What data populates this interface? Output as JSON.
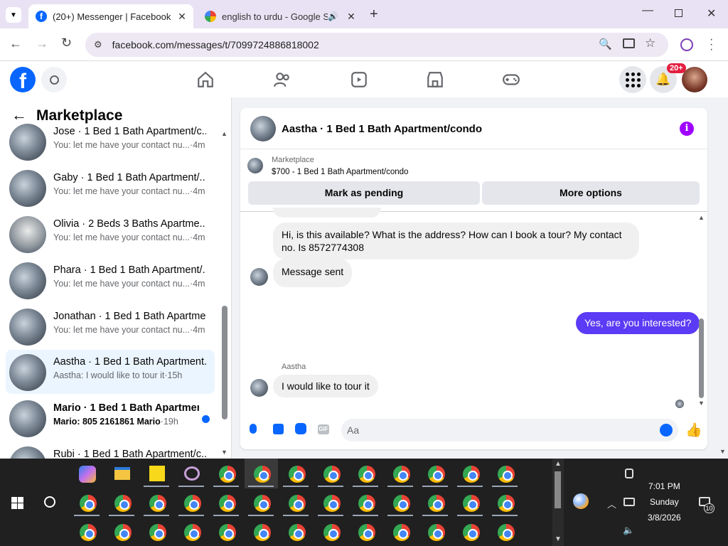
{
  "browser": {
    "tabs": [
      {
        "title": "(20+) Messenger | Facebook",
        "active": true
      },
      {
        "title": "english to urdu - Google Se",
        "active": false
      }
    ],
    "url": "facebook.com/messages/t/7099724886818002"
  },
  "fb": {
    "notification_badge": "20+",
    "brand_color": "#0866ff"
  },
  "sidebar": {
    "title": "Marketplace",
    "conversations": [
      {
        "name": "Jose · 1 Bed 1 Bath Apartment/c...",
        "snippet": "You: let me have your contact nu...",
        "time": "·4m"
      },
      {
        "name": "Gaby · 1 Bed 1 Bath Apartment/...",
        "snippet": "You: let me have your contact nu...",
        "time": "·4m"
      },
      {
        "name": "Olivia · 2 Beds 3 Baths Apartme...",
        "snippet": "You: let me have your contact nu...",
        "time": "·4m"
      },
      {
        "name": "Phara · 1 Bed 1 Bath Apartment/...",
        "snippet": "You: let me have your contact nu...",
        "time": "·4m"
      },
      {
        "name": "Jonathan · 1 Bed 1 Bath Apartme...",
        "snippet": "You: let me have your contact nu...",
        "time": "·4m"
      },
      {
        "name": "Aastha · 1 Bed 1 Bath Apartment...",
        "snippet": "Aastha: I would like to tour it",
        "time": "·15h"
      },
      {
        "name": "Mario · 1 Bed 1 Bath Apartmen...",
        "snippet": "Mario: 805 2161861 Mario",
        "time": "·19h"
      },
      {
        "name": "Rubi · 1 Bed 1 Bath Apartment/c...",
        "snippet": "",
        "time": ""
      }
    ]
  },
  "chat": {
    "title": "Aastha · 1 Bed 1 Bath Apartment/condo",
    "listing_source": "Marketplace",
    "listing_title": "$700 - 1 Bed 1 Bath Apartment/condo",
    "mark_pending": "Mark as pending",
    "more_options": "More options",
    "messages": [
      {
        "text": "Hi, is this available? What is the address? How can I book a tour? My contact no. Is 8572774308",
        "from": "them"
      },
      {
        "text": "Message sent",
        "from": "them"
      },
      {
        "text": "Yes, are you interested?",
        "from": "me"
      },
      {
        "sender": "Aastha",
        "text": "I would like to tour it",
        "from": "them"
      }
    ],
    "composer_placeholder": "Aa"
  },
  "taskbar": {
    "time": "7:01 PM",
    "day": "Sunday",
    "date": "3/8/2026",
    "notifications": "10"
  }
}
